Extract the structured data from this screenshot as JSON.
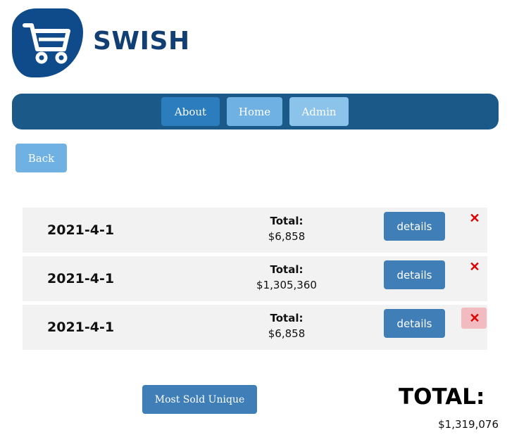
{
  "brand": {
    "name": "SWISH",
    "logo_icon": "shopping-cart-icon",
    "logo_color": "#0f4a8a"
  },
  "nav": {
    "items": [
      {
        "label": "About",
        "color": "#2b7dbd"
      },
      {
        "label": "Home",
        "color": "#6fb1e3"
      },
      {
        "label": "Admin",
        "color": "#8bc3eb"
      }
    ],
    "bar_color": "#1b5a88"
  },
  "back_label": "Back",
  "orders": [
    {
      "date": "2021-4-1",
      "total_label": "Total:",
      "total": "$6,858",
      "details_label": "details",
      "delete_icon": "close-icon"
    },
    {
      "date": "2021-4-1",
      "total_label": "Total:",
      "total": "$1,305,360",
      "details_label": "details",
      "delete_icon": "close-icon"
    },
    {
      "date": "2021-4-1",
      "total_label": "Total:",
      "total": "$6,858",
      "details_label": "details",
      "delete_icon": "close-icon"
    }
  ],
  "footer": {
    "most_sold_label": "Most Sold Unique",
    "grand_total_label": "TOTAL:",
    "grand_total_value": "$1,319,076"
  },
  "colors": {
    "button_blue": "#3f7eb6",
    "delete_red": "#e00000"
  }
}
